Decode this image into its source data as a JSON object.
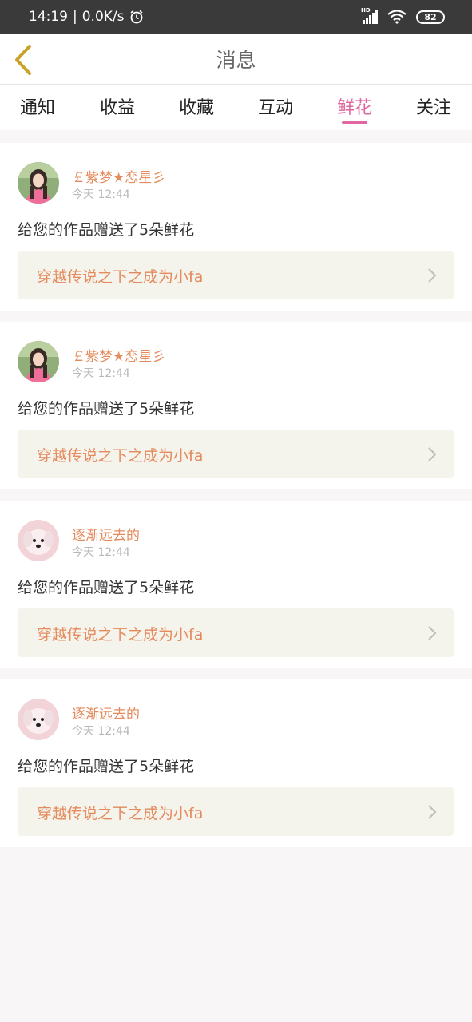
{
  "status_bar": {
    "time": "14:19",
    "separator": "|",
    "net_speed": "0.0K/s",
    "hd_label": "HD",
    "battery": "82"
  },
  "header": {
    "title": "消息"
  },
  "tabs": [
    {
      "label": "通知",
      "active": false
    },
    {
      "label": "收益",
      "active": false
    },
    {
      "label": "收藏",
      "active": false
    },
    {
      "label": "互动",
      "active": false
    },
    {
      "label": "鲜花",
      "active": true
    },
    {
      "label": "关注",
      "active": false
    }
  ],
  "messages": [
    {
      "username": "￡紫梦★恋星彡",
      "time": "今天 12:44",
      "text": "给您的作品赠送了5朵鲜花",
      "work_title": "穿越传说之下之成为小fa",
      "avatar": "girl-photo"
    },
    {
      "username": "￡紫梦★恋星彡",
      "time": "今天 12:44",
      "text": "给您的作品赠送了5朵鲜花",
      "work_title": "穿越传说之下之成为小fa",
      "avatar": "girl-photo"
    },
    {
      "username": "逐渐远去的",
      "time": "今天 12:44",
      "text": "给您的作品赠送了5朵鲜花",
      "work_title": "穿越传说之下之成为小fa",
      "avatar": "puppy-photo"
    },
    {
      "username": "逐渐远去的",
      "time": "今天 12:44",
      "text": "给您的作品赠送了5朵鲜花",
      "work_title": "穿越传说之下之成为小fa",
      "avatar": "puppy-photo"
    }
  ],
  "colors": {
    "accent": "#e0679f",
    "username": "#e48a5c",
    "back_arrow": "#c9a227"
  }
}
